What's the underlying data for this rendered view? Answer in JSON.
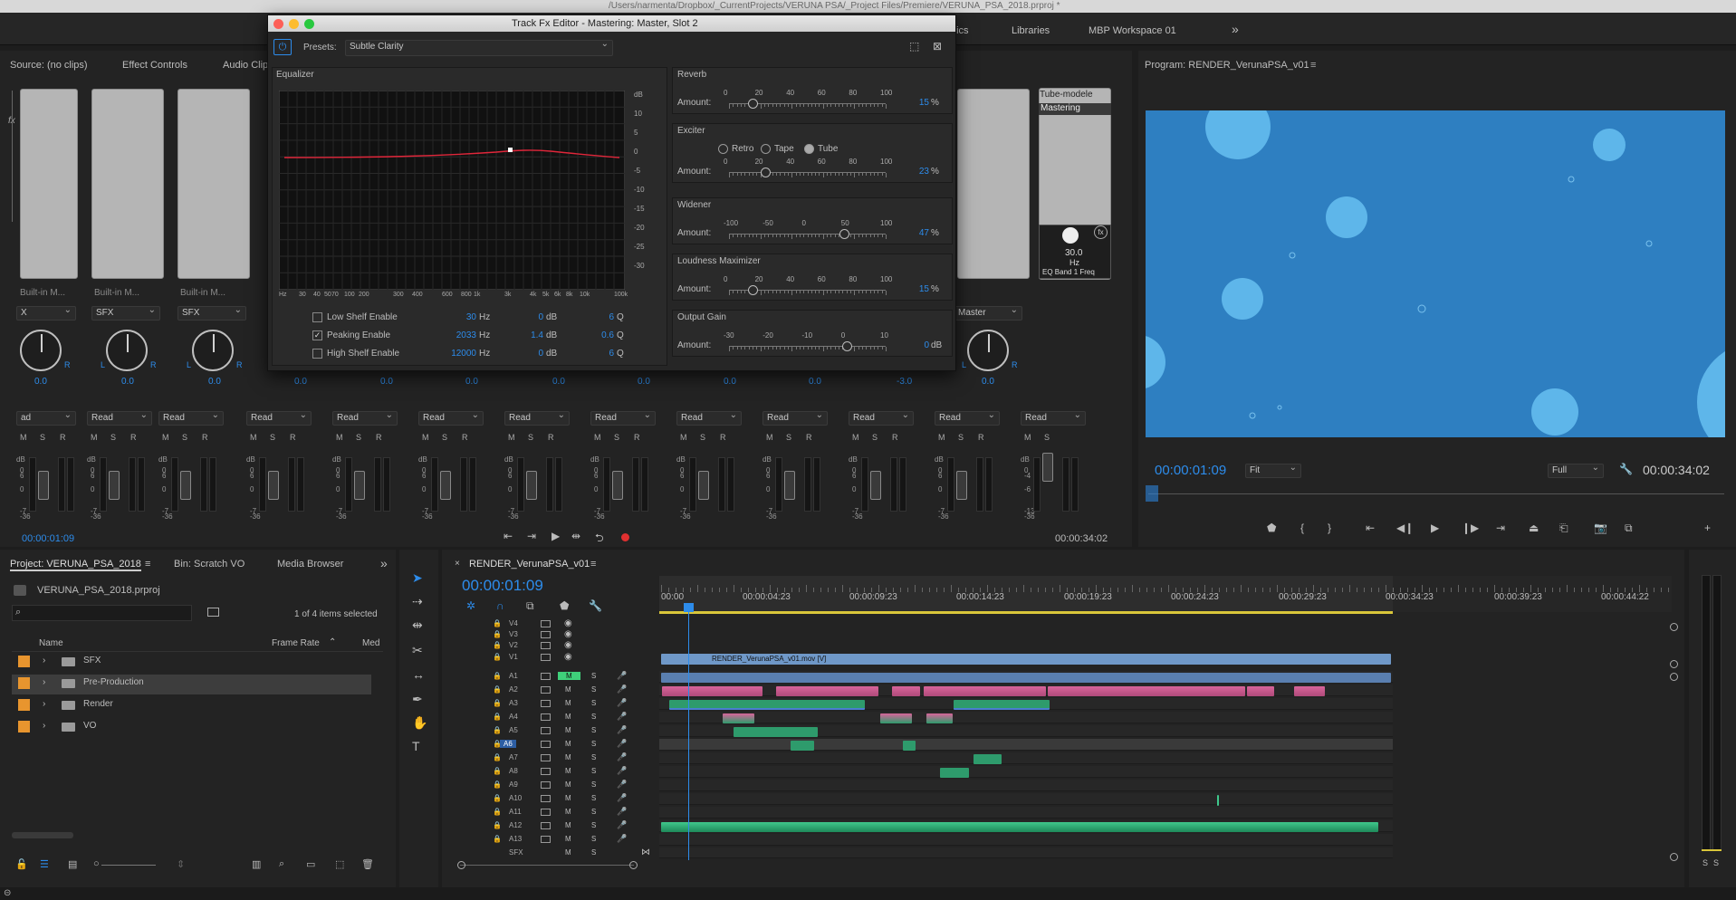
{
  "titlebar": {
    "path": "/Users/narmenta/Dropbox/_CurrentProjects/VERUNA PSA/_Project Files/Premiere/VERUNA_PSA_2018.prproj *"
  },
  "workspaces": {
    "items": [
      "nics",
      "Libraries",
      "MBP Workspace 01"
    ],
    "more": "»"
  },
  "source_panel": {
    "tabs": [
      "Source: (no clips)",
      "Effect Controls",
      "Audio Clip"
    ]
  },
  "mixer": {
    "slot_labels": [
      "Built-in M...",
      "Built-in M...",
      "Built-in M..."
    ],
    "track_names": [
      "X",
      "SFX",
      "SFX",
      "Master"
    ],
    "pan_values": [
      "0.0",
      "0.0",
      "0.0",
      "0.0",
      "0.0",
      "0.0",
      "0.0",
      "0.0",
      "0.0",
      "0.0",
      "-3.0",
      "0.0"
    ],
    "read_labels": [
      "ad",
      "Read",
      "Read",
      "Read",
      "Read",
      "Read",
      "Read",
      "Read",
      "Read",
      "Read",
      "Read",
      "Read",
      "Read"
    ],
    "msr": [
      "M",
      "S",
      "R"
    ],
    "master_msr": [
      "M",
      "S"
    ],
    "db_scale": [
      "dB",
      "0",
      "6",
      "0",
      "-7",
      "-36"
    ],
    "master_db_scale": [
      "dB",
      "0",
      "-4",
      "-6",
      "-13",
      "-36"
    ],
    "master_slot": {
      "name": "Tube-modele",
      "selected": "Mastering",
      "knob_value": "30.0",
      "knob_unit": "Hz",
      "param": "EQ Band 1 Freq"
    },
    "timecode_left": "00:00:01:09",
    "timecode_right": "00:00:34:02",
    "lr": [
      "L",
      "R"
    ]
  },
  "fx_editor": {
    "title": "Track Fx Editor - Mastering: Master, Slot 2",
    "presets_label": "Presets:",
    "preset_value": "Subtle Clarity",
    "equalizer": {
      "label": "Equalizer",
      "db_ticks": [
        "dB",
        "10",
        "5",
        "0",
        "-5",
        "-10",
        "-15",
        "-20",
        "-25",
        "-30"
      ],
      "hz_ticks": [
        "Hz",
        "30",
        "40",
        "50",
        "70",
        "100",
        "200",
        "300",
        "400",
        "600",
        "800",
        "1k",
        "3k",
        "4k",
        "5k",
        "6k",
        "8k",
        "10k",
        "100k"
      ],
      "rows": [
        {
          "label": "Low Shelf Enable",
          "checked": false,
          "freq": "30",
          "gain": "0",
          "q": "6"
        },
        {
          "label": "Peaking Enable",
          "checked": true,
          "freq": "2033",
          "gain": "1.4",
          "q": "0.6"
        },
        {
          "label": "High Shelf Enable",
          "checked": false,
          "freq": "12000",
          "gain": "0",
          "q": "6"
        }
      ],
      "units": {
        "freq": "Hz",
        "gain": "dB",
        "q": "Q"
      }
    },
    "reverb": {
      "label": "Reverb",
      "amount_label": "Amount:",
      "ticks": [
        "0",
        "20",
        "40",
        "60",
        "80",
        "100"
      ],
      "value": "15",
      "unit": "%",
      "level": 0.15
    },
    "exciter": {
      "label": "Exciter",
      "modes": [
        "Retro",
        "Tape",
        "Tube"
      ],
      "selected": "Tube",
      "amount_label": "Amount:",
      "ticks": [
        "0",
        "20",
        "40",
        "60",
        "80",
        "100"
      ],
      "value": "23",
      "unit": "%",
      "level": 0.23
    },
    "widener": {
      "label": "Widener",
      "amount_label": "Amount:",
      "ticks": [
        "-100",
        "-50",
        "0",
        "50",
        "100"
      ],
      "value": "47",
      "unit": "%",
      "level": 0.735
    },
    "loudness": {
      "label": "Loudness Maximizer",
      "amount_label": "Amount:",
      "ticks": [
        "0",
        "20",
        "40",
        "60",
        "80",
        "100"
      ],
      "value": "15",
      "unit": "%",
      "level": 0.15
    },
    "output_gain": {
      "label": "Output Gain",
      "amount_label": "Amount:",
      "ticks": [
        "-30",
        "-20",
        "-10",
        "0",
        "10"
      ],
      "value": "0",
      "unit": "dB",
      "level": 0.75
    }
  },
  "program": {
    "title": "Program: RENDER_VerunaPSA_v01",
    "timecode": "00:00:01:09",
    "fit": "Fit",
    "quality": "Full",
    "duration": "00:00:34:02",
    "frame_color": "#2e7fc1"
  },
  "project": {
    "tabs": [
      "Project: VERUNA_PSA_2018",
      "Bin: Scratch VO",
      "Media Browser"
    ],
    "file": "VERUNA_PSA_2018.prproj",
    "items_selected": "1 of 4 items selected",
    "columns": [
      "Name",
      "Frame Rate",
      "Med"
    ],
    "bins": [
      {
        "name": "SFX",
        "color": "#e8952e"
      },
      {
        "name": "Pre-Production",
        "color": "#e8952e"
      },
      {
        "name": "Render",
        "color": "#e8952e"
      },
      {
        "name": "VO",
        "color": "#e8952e"
      }
    ]
  },
  "timeline": {
    "tab": "RENDER_VerunaPSA_v01",
    "timecode": "00:00:01:09",
    "ruler": [
      "00:00",
      "00:00:04:23",
      "00:00:09:23",
      "00:00:14:23",
      "00:00:19:23",
      "00:00:24:23",
      "00:00:29:23",
      "00:00:34:23",
      "00:00:39:23",
      "00:00:44:22"
    ],
    "video_tracks": [
      "V4",
      "V3",
      "V2",
      "V1"
    ],
    "audio_tracks": [
      "A1",
      "A2",
      "A3",
      "A4",
      "A5",
      "A6",
      "A7",
      "A8",
      "A9",
      "A10",
      "A11",
      "A12",
      "A13"
    ],
    "sub_track": "SFX",
    "video_clip": "RENDER_VerunaPSA_v01.mov [V]",
    "track_buttons": [
      "M",
      "S"
    ],
    "meter_labels": [
      "S",
      "S"
    ]
  }
}
